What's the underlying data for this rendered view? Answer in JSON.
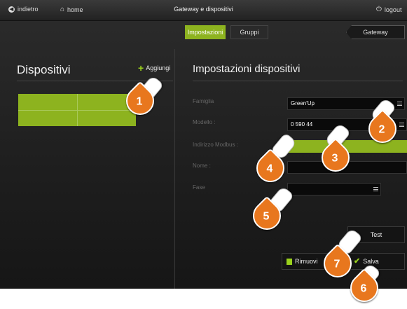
{
  "topbar": {
    "back_label": "indietro",
    "home_label": "home",
    "title": "Gateway e dispositivi",
    "logout_label": "logout"
  },
  "tabs": [
    {
      "label": "Impostazioni",
      "active": true
    },
    {
      "label": "Gruppi",
      "active": false
    }
  ],
  "gateway_tab": "Gateway",
  "left": {
    "title": "Dispositivi",
    "add_label": "Aggiungi"
  },
  "right": {
    "title": "Impostazioni dispositivi",
    "fields": [
      {
        "label": "Famiglia",
        "value": "Green'Up"
      },
      {
        "label": "Modello :",
        "value": "0 590 44"
      },
      {
        "label": "Indirizzo Modbus :",
        "value": ""
      },
      {
        "label": "Nome :",
        "value": ""
      },
      {
        "label": "Fase",
        "value": ""
      }
    ],
    "test_label": "Test",
    "remove_label": "Rimuovi",
    "save_label": "Salva"
  },
  "callouts": [
    "1",
    "2",
    "3",
    "4",
    "5",
    "6",
    "7"
  ],
  "colors": {
    "accent": "#8db31f",
    "callout": "#e8771e",
    "background": "#1e1e1e"
  }
}
